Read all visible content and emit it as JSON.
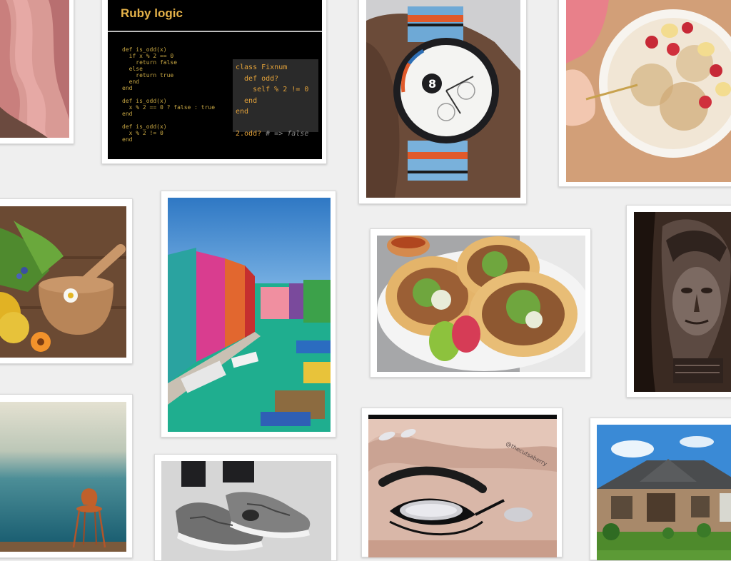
{
  "pins": {
    "ruby": {
      "title": "Ruby logic",
      "code_left": "def is_odd(x)\n  if x % 2 == 0\n    return false\n  else\n    return true\n  end\nend\n\ndef is_odd(x)\n  x % 2 == 0 ? false : true\nend\n\ndef is_odd(x)\n  x % 2 != 0\nend",
      "code_right_lines": [
        "class Fixnum",
        "  def odd?",
        "    self % 2 != 0",
        "  end",
        "end",
        ""
      ],
      "code_right_call": "2.odd?",
      "code_right_comment": " # => false"
    },
    "eye": {
      "watermark": "@thecutsaberry"
    },
    "watch": {
      "dial_number": "8"
    }
  },
  "colors": {
    "background": "#efefef",
    "card": "#ffffff",
    "ruby_title": "#e6b34a",
    "ruby_code": "#e3a23a"
  }
}
